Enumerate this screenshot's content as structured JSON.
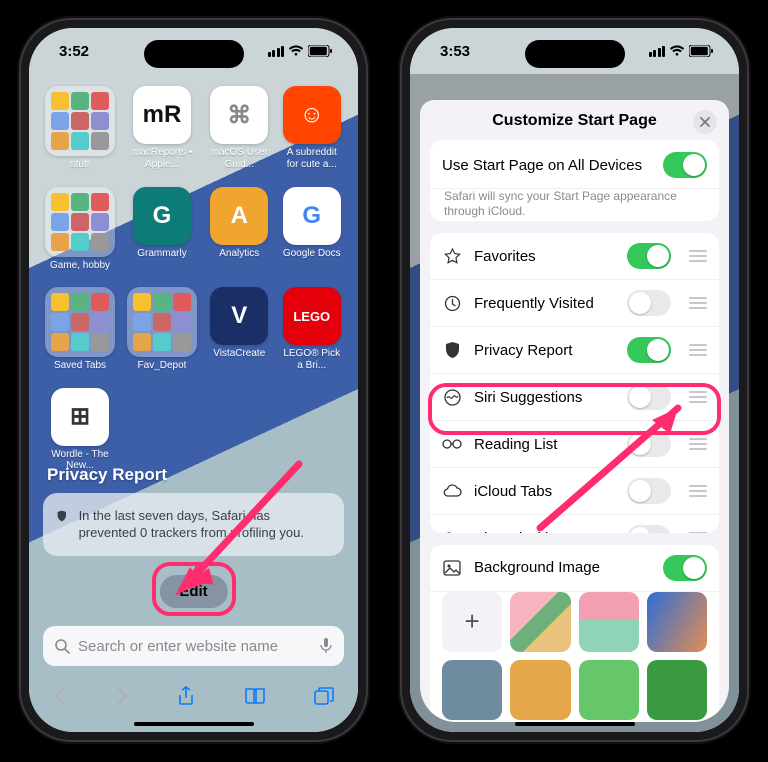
{
  "phone1": {
    "time": "3:52",
    "apps": [
      {
        "label": "stuff",
        "txt": "",
        "folder": true
      },
      {
        "label": "macReports • Apple...",
        "txt": "mR",
        "bg": "#ffffff",
        "fg": "#111"
      },
      {
        "label": "macOS User Guid...",
        "txt": "⌘",
        "bg": "#ffffff",
        "fg": "#888"
      },
      {
        "label": "A subreddit for cute a...",
        "txt": "☺",
        "bg": "#ff4500",
        "fg": "#fff"
      },
      {
        "label": "Game, hobby",
        "txt": "",
        "folder": true
      },
      {
        "label": "Grammarly",
        "txt": "G",
        "bg": "#0d7b76",
        "fg": "#fff"
      },
      {
        "label": "Analytics",
        "txt": "A",
        "bg": "#f0a52e",
        "fg": "#fff"
      },
      {
        "label": "Google Docs",
        "txt": "G",
        "bg": "#ffffff",
        "fg": "#4285f4"
      },
      {
        "label": "Saved Tabs",
        "txt": "",
        "folder": true
      },
      {
        "label": "Fav_Depot",
        "txt": "",
        "folder": true
      },
      {
        "label": "VistaCreate",
        "txt": "V",
        "bg": "#1a2f66",
        "fg": "#fff"
      },
      {
        "label": "LEGO® Pick a Bri...",
        "txt": "LEGO",
        "bg": "#e3000b",
        "fg": "#fff",
        "fs": "13px"
      },
      {
        "label": "Wordle - The New...",
        "txt": "⊞",
        "bg": "#ffffff",
        "fg": "#333"
      }
    ],
    "privacy_report_title": "Privacy Report",
    "privacy_report_text": "In the last seven days, Safari has prevented 0 trackers from profiling you.",
    "edit_label": "Edit",
    "search_placeholder": "Search or enter website name"
  },
  "phone2": {
    "time": "3:53",
    "sheet_title": "Customize Start Page",
    "all_devices_label": "Use Start Page on All Devices",
    "all_devices_sub": "Safari will sync your Start Page appearance through iCloud.",
    "items": [
      {
        "icon": "star",
        "label": "Favorites",
        "on": true
      },
      {
        "icon": "clock",
        "label": "Frequently Visited",
        "on": false
      },
      {
        "icon": "shield",
        "label": "Privacy Report",
        "on": true
      },
      {
        "icon": "siri",
        "label": "Siri Suggestions",
        "on": false
      },
      {
        "icon": "glasses",
        "label": "Reading List",
        "on": false
      },
      {
        "icon": "cloud",
        "label": "iCloud Tabs",
        "on": false
      },
      {
        "icon": "people",
        "label": "Shared with You",
        "on": false
      }
    ],
    "bg_label": "Background Image",
    "bg_on": true,
    "bg_tiles": [
      {
        "bg": "#f2f2f7",
        "plus": true
      },
      {
        "bg": "linear-gradient(135deg,#f6b4c0 40%,#6cb07a 40% 60%,#e9c27b 60%)"
      },
      {
        "bg": "linear-gradient(180deg,#f29fb2 45%,#8fd4b7 45%)"
      },
      {
        "bg": "linear-gradient(120deg,#2e6dd6,#e38e52)"
      },
      {
        "bg": "#6f8ba0"
      },
      {
        "bg": "#e6a74a"
      },
      {
        "bg": "#66c76a"
      },
      {
        "bg": "#3a9a3f"
      }
    ]
  }
}
